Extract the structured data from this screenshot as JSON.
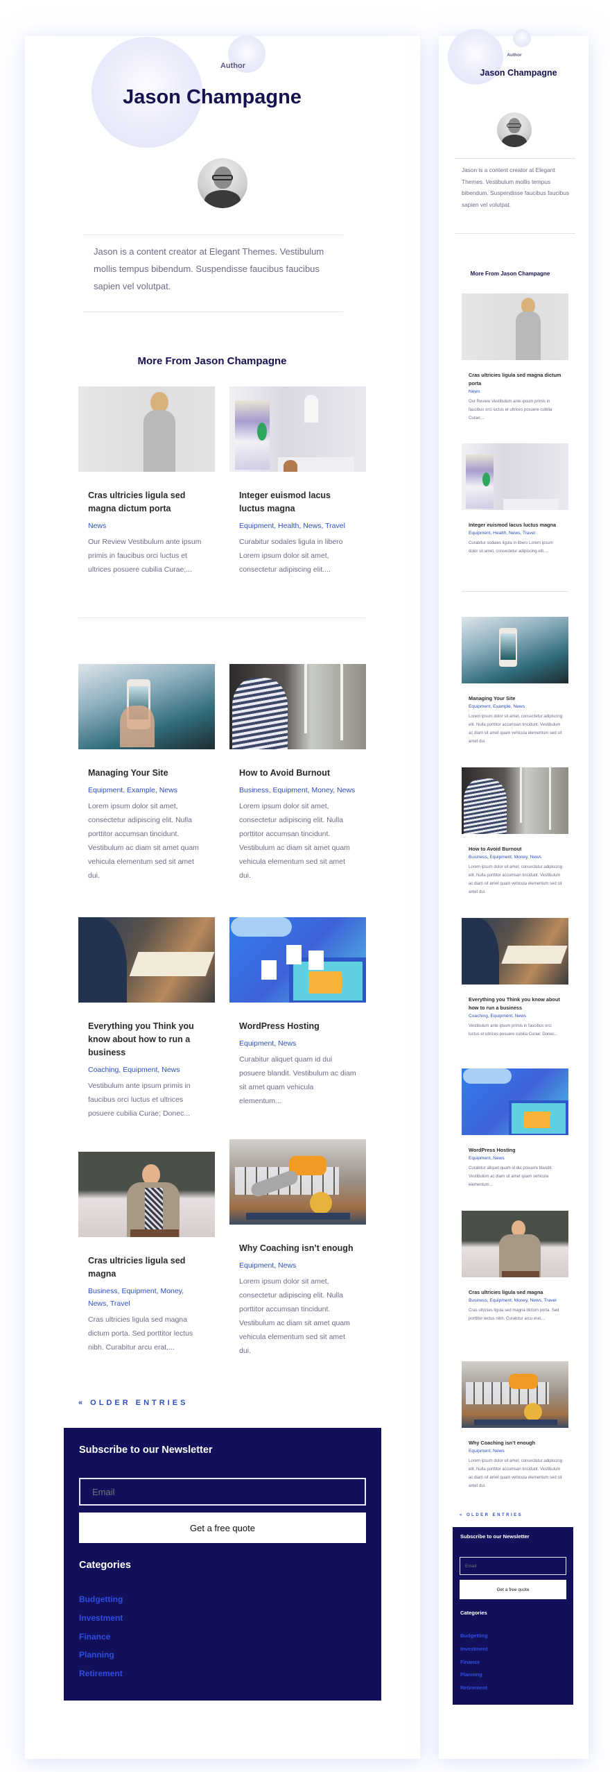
{
  "author": {
    "label": "Author",
    "name": "Jason Champagne",
    "bio": "Jason is a content creator at Elegant Themes. Vestibulum mollis tempus bibendum. Suspendisse faucibus faucibus sapien vel volutpat."
  },
  "more_section": {
    "title": "More From Jason Champagne"
  },
  "posts": [
    {
      "title": "Cras ultricies ligula sed magna dictum porta",
      "categories": "News",
      "excerpt": "Our Review Vestibulum ante ipsum primis in faucibus orci luctus et ultrices posuere cubilia Curae;...",
      "image": "woman-gray-sweater"
    },
    {
      "title": "Integer euismod lacus luctus magna",
      "categories": "Equipment, Health, News, Travel",
      "excerpt": "Curabitur sodales ligula in libero Lorem ipsum dolor sit amet, consectetur adipiscing elit....",
      "image": "bright-room"
    },
    {
      "title": "Managing Your Site",
      "categories": "Equipment, Example, News",
      "excerpt": "Lorem ipsum dolor sit amet, consectetur adipiscing elit. Nulla porttitor accumsan tincidunt. Vestibulum ac diam sit amet quam vehicula elementum sed sit amet dui.",
      "image": "phone-photo"
    },
    {
      "title": "How to Avoid Burnout",
      "categories": "Business, Equipment, Money, News",
      "excerpt": "Lorem ipsum dolor sit amet, consectetur adipiscing elit. Nulla porttitor accumsan tincidunt. Vestibulum ac diam sit amet quam vehicula elementum sed sit amet dui.",
      "image": "woman-window"
    },
    {
      "title": "Everything you Think you know about how to run a business",
      "categories": "Coaching, Equipment, News",
      "excerpt": "Vestibulum ante ipsum primis in faucibus orci luctus et ultrices posuere cubilia Curae; Donec...",
      "image": "business-meeting"
    },
    {
      "title": "WordPress Hosting",
      "categories": "Equipment, News",
      "excerpt": "Curabitur aliquet quam id dui posuere blandit. Vestibulum ac diam sit amet quam vehicula elementum...",
      "image": "hosting-illustration"
    },
    {
      "title": "Cras ultricies ligula sed magna",
      "categories": "Business, Equipment, Money, News, Travel",
      "excerpt": "Cras ultricies ligula sed magna dictum porta. Sed porttitor lectus nibh. Curabitur arcu erat,...",
      "image": "woman-laptop"
    },
    {
      "title": "Why Coaching isn’t enough",
      "categories": "Equipment, News",
      "excerpt": "Lorem ipsum dolor sit amet, consectetur adipiscing elit. Nulla porttitor accumsan tincidunt. Vestibulum ac diam sit amet quam vehicula elementum sed sit amet dui.",
      "image": "gym-workout"
    }
  ],
  "pagination": {
    "older_entries": "« OLDER ENTRIES"
  },
  "newsletter": {
    "title": "Subscribe to our Newsletter",
    "email_placeholder": "Email",
    "button_label": "Get a free quote"
  },
  "categories": {
    "title": "Categories",
    "items": [
      "Budgetting",
      "Investment",
      "Finance",
      "Planning",
      "Retirement"
    ]
  },
  "colors": {
    "navy": "#12105a",
    "title_navy": "#14124f",
    "link_blue": "#2c4fbf",
    "category_blue": "#2f4de0",
    "body_text": "#6c6b88"
  }
}
